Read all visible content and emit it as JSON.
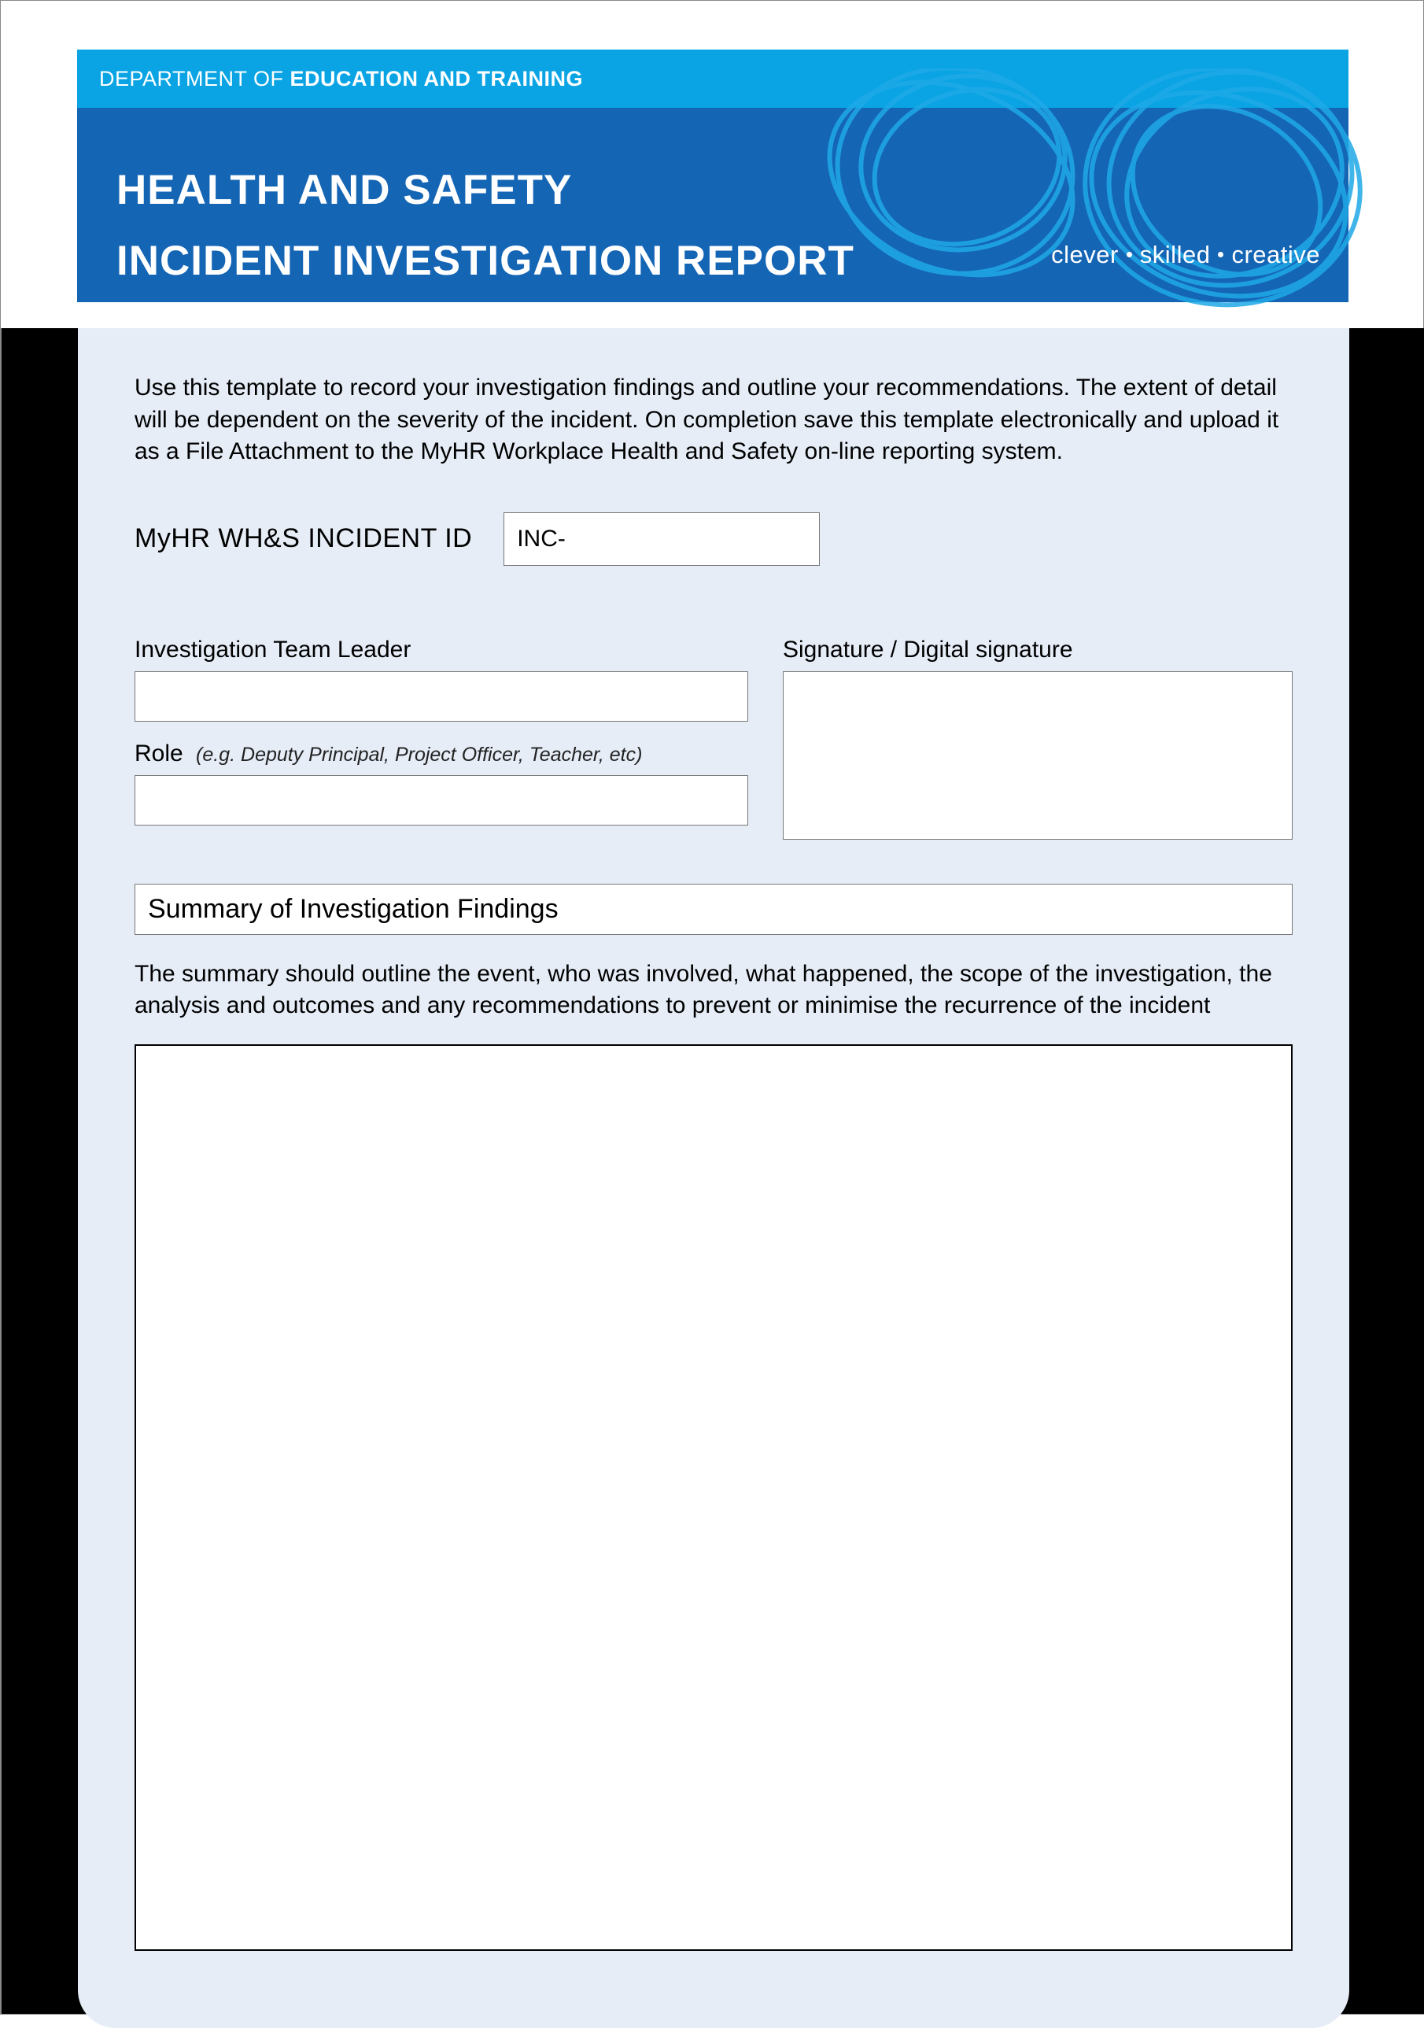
{
  "banner": {
    "department_prefix": "DEPARTMENT OF ",
    "department_bold": "EDUCATION AND TRAINING",
    "title_line1": "HEALTH AND SAFETY",
    "title_line2": "INCIDENT INVESTIGATION REPORT",
    "tag_clever": "clever",
    "tag_skilled": "skilled",
    "tag_creative": "creative"
  },
  "form": {
    "intro": "Use this template to record your investigation findings and outline your recommendations. The extent of detail will be dependent on the severity of the incident. On completion save this template electronically and upload it as a File Attachment to the MyHR Workplace Health and Safety on-line reporting system.",
    "incident_id_label": "MyHR WH&S INCIDENT ID",
    "incident_id_value": "INC-",
    "leader_label": "Investigation Team Leader",
    "leader_value": "",
    "role_label": "Role",
    "role_hint": "(e.g. Deputy Principal, Project Officer, Teacher, etc)",
    "role_value": "",
    "signature_label": "Signature / Digital signature",
    "summary_heading": "Summary of Investigation Findings",
    "summary_helper": "The summary should outline the event, who was involved, what happened, the scope of the investigation, the analysis and outcomes and any recommendations to prevent or minimise the recurrence of the incident",
    "summary_value": ""
  }
}
